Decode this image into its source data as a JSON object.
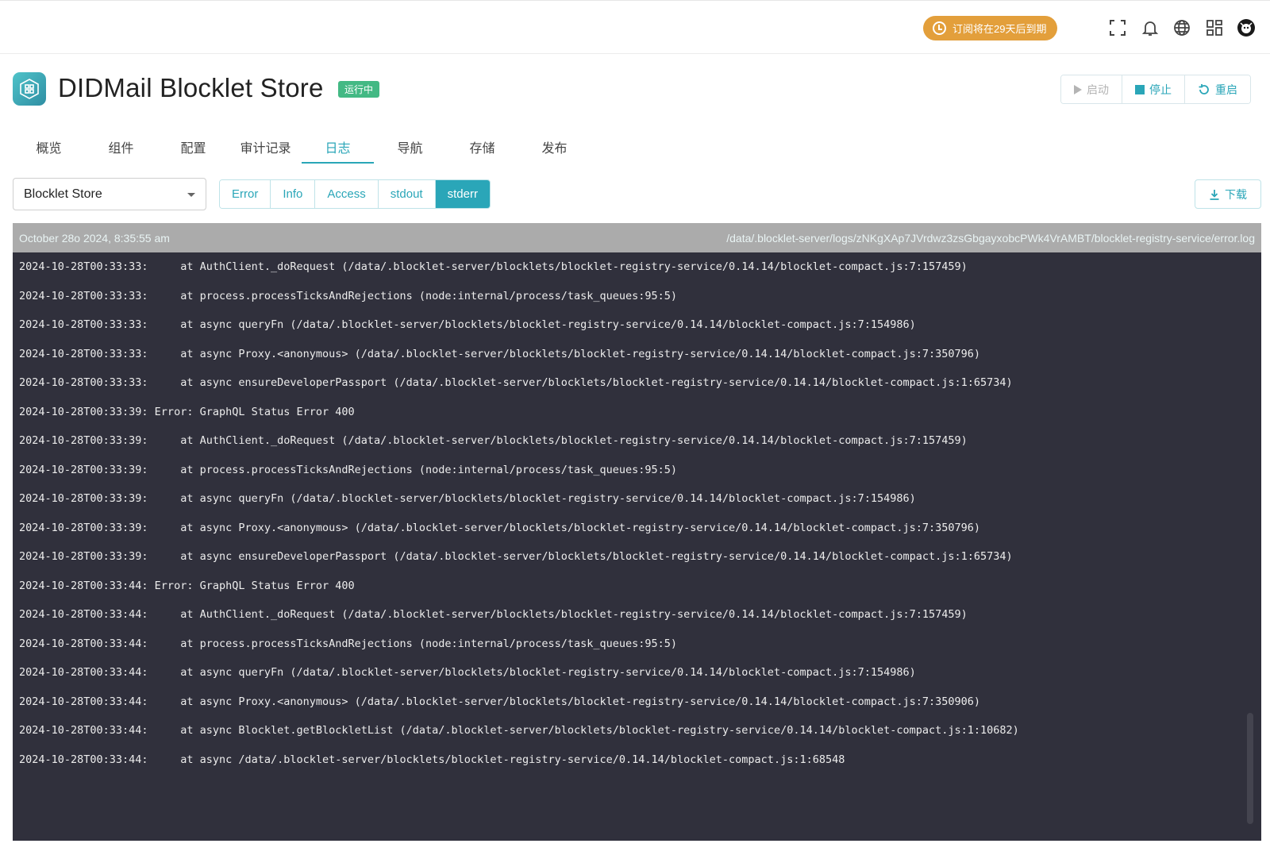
{
  "topbar": {
    "subscription_label": "订阅将在29天后到期",
    "icons": [
      "fullscreen-icon",
      "bell-icon",
      "globe-icon",
      "apps-grid-icon",
      "avatar"
    ]
  },
  "header": {
    "title": "DIDMail Blocklet Store",
    "status": "运行中",
    "actions": {
      "start": "启动",
      "stop": "停止",
      "restart": "重启"
    }
  },
  "tabs": [
    "概览",
    "组件",
    "配置",
    "审计记录",
    "日志",
    "导航",
    "存储",
    "发布"
  ],
  "active_tab": "日志",
  "controls": {
    "component_select": "Blocklet Store",
    "log_types": [
      "Error",
      "Info",
      "Access",
      "stdout",
      "stderr"
    ],
    "active_log_type": "stderr",
    "download_label": "下载"
  },
  "log": {
    "date": "October 28o 2024, 8:35:55 am",
    "path": "/data/.blocklet-server/logs/zNKgXAp7JVrdwz3zsGbgayxobcPWk4VrAMBT/blocklet-registry-service/error.log",
    "lines": [
      "2024-10-28T00:33:33:     at AuthClient._doRequest (/data/.blocklet-server/blocklets/blocklet-registry-service/0.14.14/blocklet-compact.js:7:157459)",
      "2024-10-28T00:33:33:     at process.processTicksAndRejections (node:internal/process/task_queues:95:5)",
      "2024-10-28T00:33:33:     at async queryFn (/data/.blocklet-server/blocklets/blocklet-registry-service/0.14.14/blocklet-compact.js:7:154986)",
      "2024-10-28T00:33:33:     at async Proxy.<anonymous> (/data/.blocklet-server/blocklets/blocklet-registry-service/0.14.14/blocklet-compact.js:7:350796)",
      "2024-10-28T00:33:33:     at async ensureDeveloperPassport (/data/.blocklet-server/blocklets/blocklet-registry-service/0.14.14/blocklet-compact.js:1:65734)",
      "2024-10-28T00:33:39: Error: GraphQL Status Error 400",
      "2024-10-28T00:33:39:     at AuthClient._doRequest (/data/.blocklet-server/blocklets/blocklet-registry-service/0.14.14/blocklet-compact.js:7:157459)",
      "2024-10-28T00:33:39:     at process.processTicksAndRejections (node:internal/process/task_queues:95:5)",
      "2024-10-28T00:33:39:     at async queryFn (/data/.blocklet-server/blocklets/blocklet-registry-service/0.14.14/blocklet-compact.js:7:154986)",
      "2024-10-28T00:33:39:     at async Proxy.<anonymous> (/data/.blocklet-server/blocklets/blocklet-registry-service/0.14.14/blocklet-compact.js:7:350796)",
      "2024-10-28T00:33:39:     at async ensureDeveloperPassport (/data/.blocklet-server/blocklets/blocklet-registry-service/0.14.14/blocklet-compact.js:1:65734)",
      "2024-10-28T00:33:44: Error: GraphQL Status Error 400",
      "2024-10-28T00:33:44:     at AuthClient._doRequest (/data/.blocklet-server/blocklets/blocklet-registry-service/0.14.14/blocklet-compact.js:7:157459)",
      "2024-10-28T00:33:44:     at process.processTicksAndRejections (node:internal/process/task_queues:95:5)",
      "2024-10-28T00:33:44:     at async queryFn (/data/.blocklet-server/blocklets/blocklet-registry-service/0.14.14/blocklet-compact.js:7:154986)",
      "2024-10-28T00:33:44:     at async Proxy.<anonymous> (/data/.blocklet-server/blocklets/blocklet-registry-service/0.14.14/blocklet-compact.js:7:350906)",
      "2024-10-28T00:33:44:     at async Blocklet.getBlockletList (/data/.blocklet-server/blocklets/blocklet-registry-service/0.14.14/blocklet-compact.js:1:10682)",
      "2024-10-28T00:33:44:     at async /data/.blocklet-server/blocklets/blocklet-registry-service/0.14.14/blocklet-compact.js:1:68548"
    ]
  },
  "colors": {
    "accent": "#2aa6b8",
    "status_green": "#43b984",
    "subscription_orange": "#e39f3b",
    "log_background": "#30303c",
    "log_header": "#ababab"
  }
}
